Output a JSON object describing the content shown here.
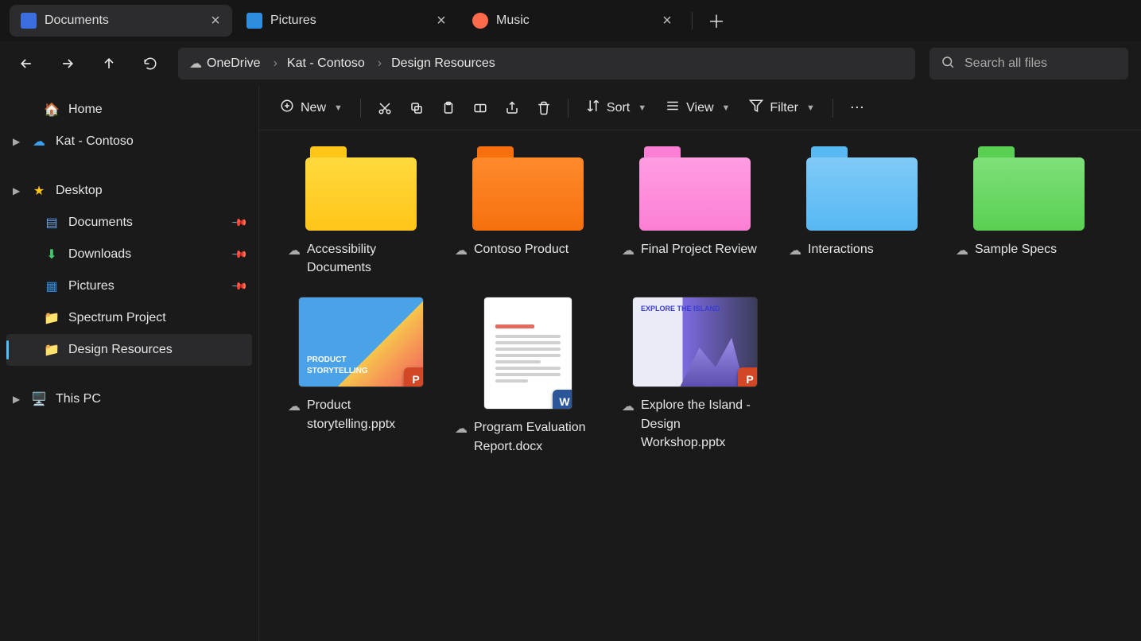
{
  "tabs": [
    {
      "label": "Documents",
      "icon": "doc",
      "active": true
    },
    {
      "label": "Pictures",
      "icon": "pic",
      "active": false
    },
    {
      "label": "Music",
      "icon": "mus",
      "active": false
    }
  ],
  "breadcrumb": {
    "root": "OneDrive",
    "mid": "Kat - Contoso",
    "leaf": "Design Resources"
  },
  "search": {
    "placeholder": "Search all files"
  },
  "sidebar": {
    "home": "Home",
    "account": "Kat - Contoso",
    "desktop": "Desktop",
    "documents": "Documents",
    "downloads": "Downloads",
    "pictures": "Pictures",
    "spectrum": "Spectrum Project",
    "design": "Design Resources",
    "thispc": "This PC"
  },
  "toolbar": {
    "new": "New",
    "sort": "Sort",
    "view": "View",
    "filter": "Filter"
  },
  "items": {
    "folders": [
      {
        "name": "Accessibility Documents",
        "color": "yellow"
      },
      {
        "name": "Contoso Product",
        "color": "orange"
      },
      {
        "name": "Final Project Review",
        "color": "pink"
      },
      {
        "name": "Interactions",
        "color": "blue"
      },
      {
        "name": "Sample Specs",
        "color": "green"
      }
    ],
    "files": [
      {
        "name": "Product storytelling.pptx",
        "app": "ppt",
        "thumb": "slide1"
      },
      {
        "name": "Program Evaluation Report.docx",
        "app": "doc",
        "thumb": "docx"
      },
      {
        "name": "Explore the Island - Design Workshop.pptx",
        "app": "ppt",
        "thumb": "slide3"
      }
    ],
    "thumb_text": {
      "slide1a": "PRODUCT",
      "slide1b": "STORYTELLING",
      "slide3": "EXPLORE THE ISLAND"
    }
  }
}
